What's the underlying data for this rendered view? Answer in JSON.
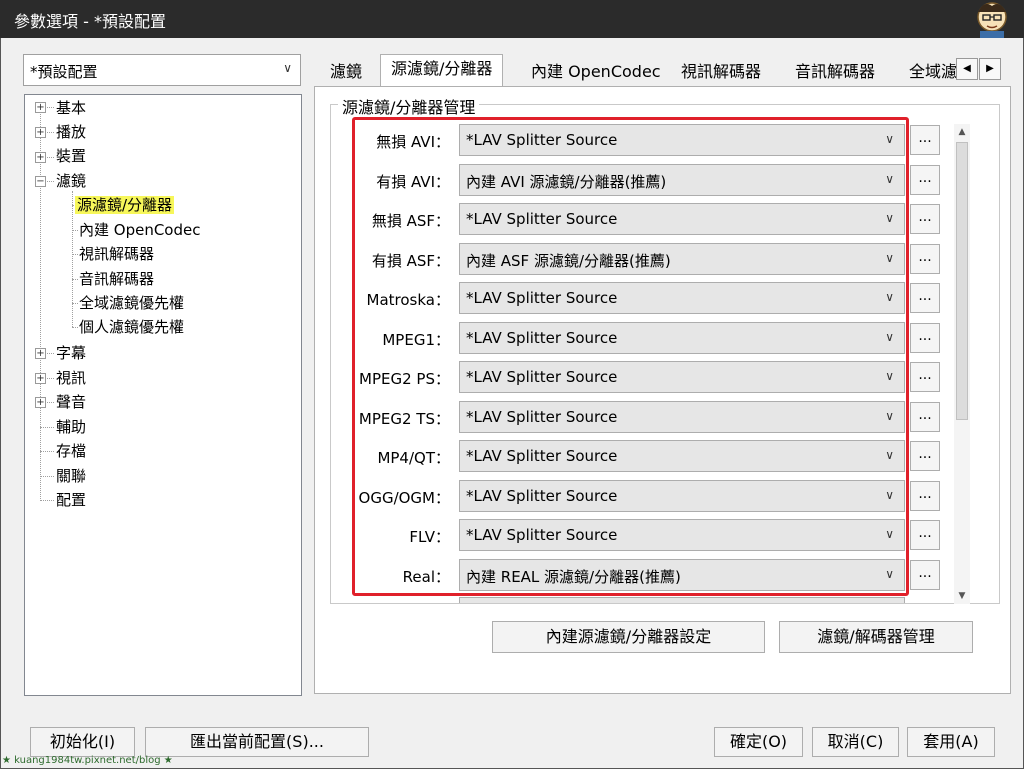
{
  "window": {
    "title": "參數選項 - *預設配置"
  },
  "profile_select": {
    "value": "*預設配置"
  },
  "tree": {
    "nodes": [
      {
        "label": "基本"
      },
      {
        "label": "播放"
      },
      {
        "label": "裝置"
      },
      {
        "label": "濾鏡"
      },
      {
        "label": "源濾鏡/分離器"
      },
      {
        "label": "內建 OpenCodec"
      },
      {
        "label": "視訊解碼器"
      },
      {
        "label": "音訊解碼器"
      },
      {
        "label": "全域濾鏡優先權"
      },
      {
        "label": "個人濾鏡優先權"
      },
      {
        "label": "字幕"
      },
      {
        "label": "視訊"
      },
      {
        "label": "聲音"
      },
      {
        "label": "輔助"
      },
      {
        "label": "存檔"
      },
      {
        "label": "關聯"
      },
      {
        "label": "配置"
      }
    ]
  },
  "tabs": [
    {
      "label": "濾鏡"
    },
    {
      "label": "源濾鏡/分離器"
    },
    {
      "label": "內建 OpenCodec"
    },
    {
      "label": "視訊解碼器"
    },
    {
      "label": "音訊解碼器"
    },
    {
      "label": "全域濾"
    }
  ],
  "group": {
    "title": "源濾鏡/分離器管理"
  },
  "rows": [
    {
      "label": "無損 AVI：",
      "value": "*LAV Splitter Source"
    },
    {
      "label": "有損 AVI：",
      "value": "內建 AVI 源濾鏡/分離器(推薦)"
    },
    {
      "label": "無損 ASF：",
      "value": "*LAV Splitter Source"
    },
    {
      "label": "有損 ASF：",
      "value": "內建 ASF 源濾鏡/分離器(推薦)"
    },
    {
      "label": "Matroska：",
      "value": "*LAV Splitter Source"
    },
    {
      "label": "MPEG1：",
      "value": "*LAV Splitter Source"
    },
    {
      "label": "MPEG2 PS：",
      "value": "*LAV Splitter Source"
    },
    {
      "label": "MPEG2 TS：",
      "value": "*LAV Splitter Source"
    },
    {
      "label": "MP4/QT：",
      "value": "*LAV Splitter Source"
    },
    {
      "label": "OGG/OGM：",
      "value": "*LAV Splitter Source"
    },
    {
      "label": "FLV：",
      "value": "*LAV Splitter Source"
    },
    {
      "label": "Real：",
      "value": "內建 REAL 源濾鏡/分離器(推薦)"
    }
  ],
  "more_button": {
    "label": "..."
  },
  "actions": {
    "builtin_settings": "內建源濾鏡/分離器設定",
    "filter_manager": "濾鏡/解碼器管理"
  },
  "footer": {
    "init": "初始化(I)",
    "export": "匯出當前配置(S)...",
    "ok": "確定(O)",
    "cancel": "取消(C)",
    "apply": "套用(A)"
  },
  "watermark": "★ kuang1984tw.pixnet.net/blog ★",
  "colors": {
    "titlebar": "#2b2b2b",
    "highlight": "#f7f75a",
    "annotation": "#e0202a"
  },
  "icons": {
    "expand": "plus-box-icon",
    "collapse": "minus-box-icon",
    "dropdown": "chevron-down-icon"
  }
}
